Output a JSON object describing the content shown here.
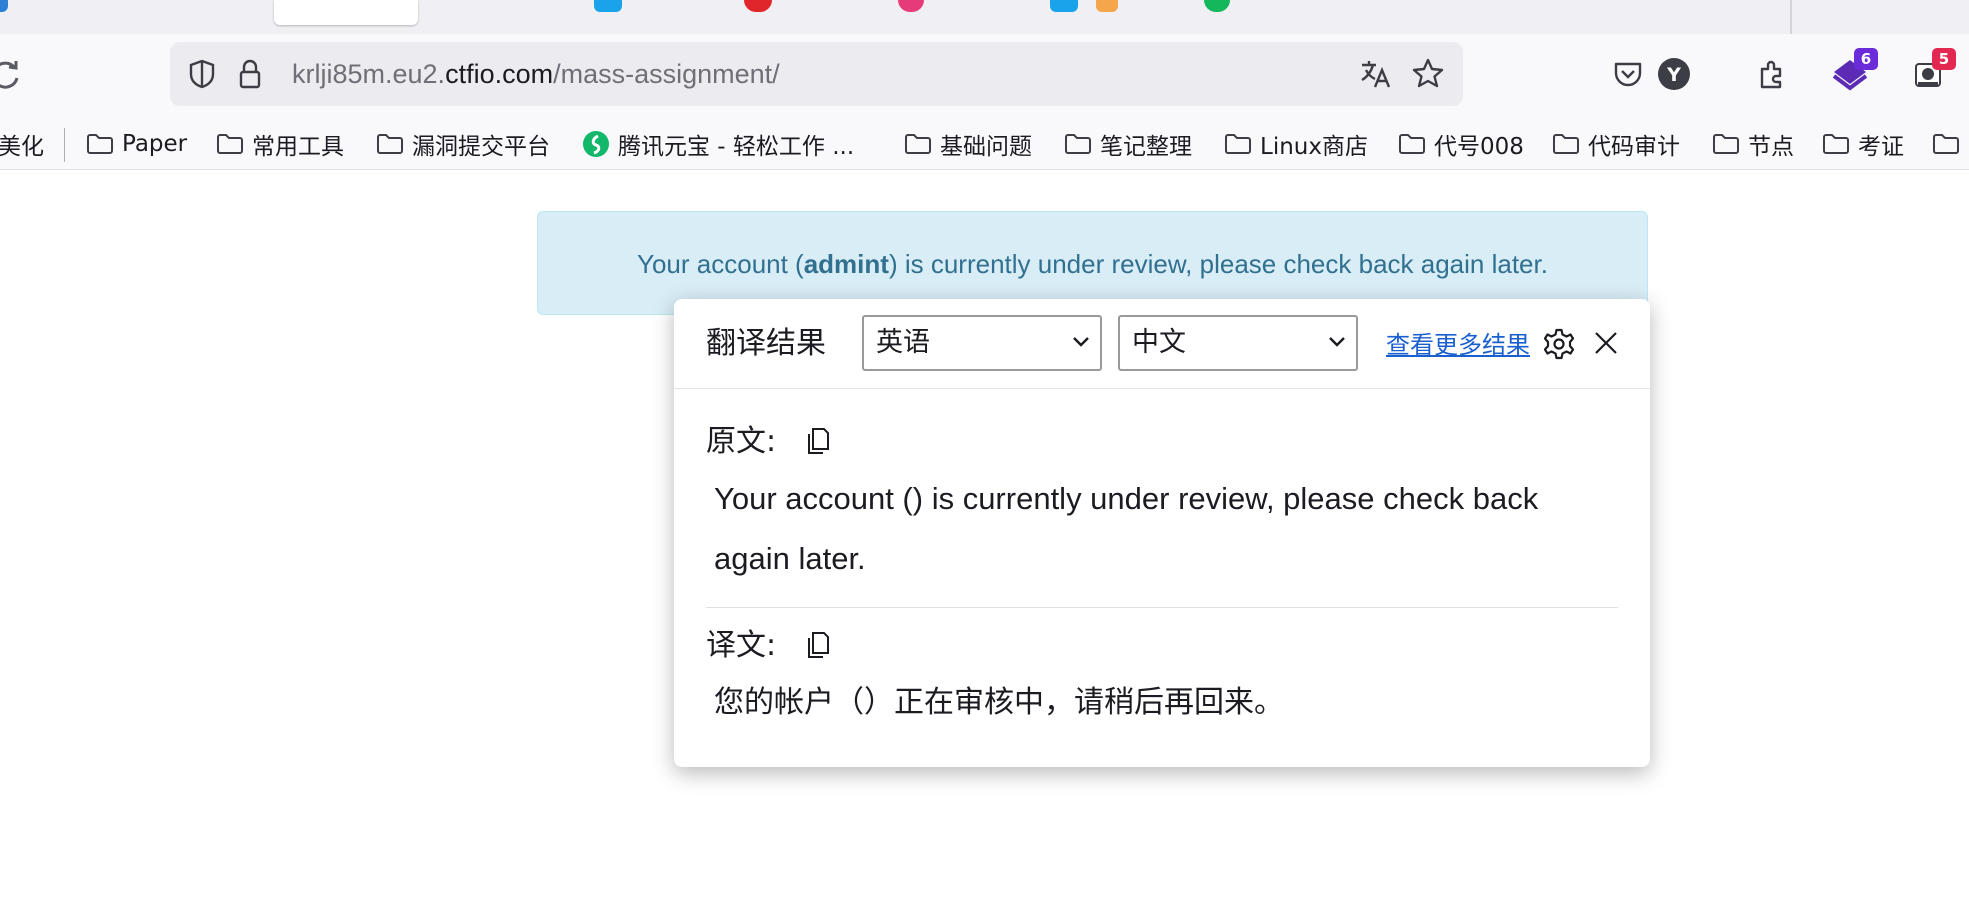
{
  "browser": {
    "url_prefix": "krlji85m.eu2.",
    "url_host": "ctfio.com",
    "url_path": "/mass-assignment/",
    "extension_badges": {
      "purple": "6",
      "red": "5"
    },
    "avatar_letter": "Y"
  },
  "bookmarks": [
    {
      "label": "美化",
      "icon": "none"
    },
    {
      "label": "Paper",
      "icon": "folder-icon"
    },
    {
      "label": "常用工具",
      "icon": "folder-icon"
    },
    {
      "label": "漏洞提交平台",
      "icon": "folder-icon"
    },
    {
      "label": "腾讯元宝 - 轻松工作 ...",
      "icon": "yuanbao-icon"
    },
    {
      "label": "基础问题",
      "icon": "folder-icon"
    },
    {
      "label": "笔记整理",
      "icon": "folder-icon"
    },
    {
      "label": "Linux商店",
      "icon": "folder-icon"
    },
    {
      "label": "代号008",
      "icon": "folder-icon"
    },
    {
      "label": "代码审计",
      "icon": "folder-icon"
    },
    {
      "label": "节点",
      "icon": "folder-icon"
    },
    {
      "label": "考证",
      "icon": "folder-icon"
    }
  ],
  "alert": {
    "prefix": "Your account (",
    "username": "admint",
    "suffix": ") is currently under review, please check back again later."
  },
  "translator": {
    "title": "翻译结果",
    "source_lang": "英语",
    "target_lang": "中文",
    "more_link": "查看更多结果",
    "source_label": "原文:",
    "source_text": "Your account () is currently under review, please check back again later.",
    "target_label": "译文:",
    "target_text": "您的帐户（）正在审核中，请稍后再回来。"
  },
  "colors": {
    "alert_bg": "#d9edf7",
    "alert_text": "#31708f",
    "link": "#1a5fd0",
    "badge_purple": "#6b2bd9",
    "badge_red": "#e22850"
  }
}
